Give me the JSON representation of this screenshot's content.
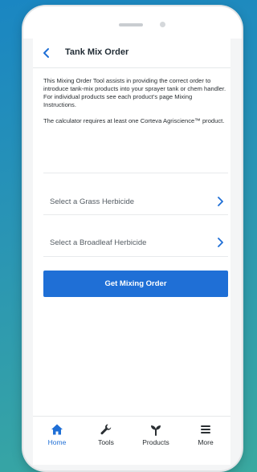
{
  "header": {
    "title": "Tank Mix Order",
    "back_icon": "chevron-left-icon"
  },
  "description": {
    "paragraph1": "This Mixing Order Tool assists in providing the correct order to introduce tank-mix products into your sprayer tank or chem handler. For individual products see each product’s page Mixing Instructions.",
    "paragraph2": "The calculator requires at least one Corteva Agriscience™ product."
  },
  "selects": [
    {
      "label": "Select a Grass Herbicide",
      "icon": "chevron-right-icon"
    },
    {
      "label": "Select a Broadleaf Herbicide",
      "icon": "chevron-right-icon"
    }
  ],
  "button": {
    "label": "Get Mixing Order"
  },
  "tabs": [
    {
      "label": "Home",
      "icon": "home-icon",
      "active": true
    },
    {
      "label": "Tools",
      "icon": "wrench-icon",
      "active": false
    },
    {
      "label": "Products",
      "icon": "sprout-icon",
      "active": false
    },
    {
      "label": "More",
      "icon": "menu-icon",
      "active": false
    }
  ],
  "colors": {
    "accent": "#1f6fd6",
    "background_top": "#1a86c2",
    "background_bottom": "#3aa9a0",
    "text": "#2a2f33"
  }
}
